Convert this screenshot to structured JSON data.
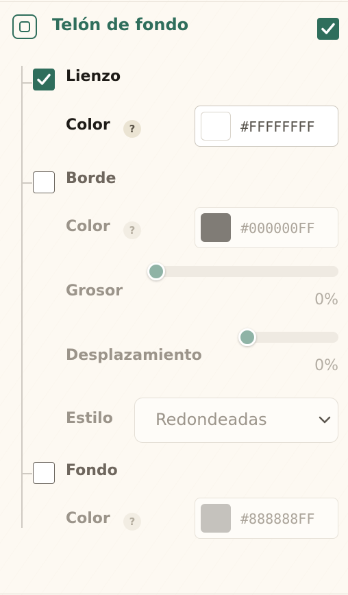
{
  "header": {
    "title": "Telón de fondo",
    "enabled": true
  },
  "sections": {
    "lienzo": {
      "label": "Lienzo",
      "checked": true,
      "color": {
        "label": "Color",
        "help": "?",
        "hex": "#FFFFFFFF",
        "swatch": "#ffffff"
      }
    },
    "borde": {
      "label": "Borde",
      "checked": false,
      "color": {
        "label": "Color",
        "help": "?",
        "hex": "#000000FF",
        "swatch": "#807c76"
      },
      "grosor": {
        "label": "Grosor",
        "value": "0%",
        "level": 0
      },
      "desplazamiento": {
        "label": "Desplazamiento",
        "value": "0%",
        "level": 0
      },
      "estilo": {
        "label": "Estilo",
        "selected": "Redondeadas"
      }
    },
    "fondo": {
      "label": "Fondo",
      "checked": false,
      "color": {
        "label": "Color",
        "help": "?",
        "hex": "#888888FF",
        "swatch": "#c5c2bd"
      }
    }
  },
  "colors": {
    "accent": "#2f6e5c",
    "background": "#fdf9f2",
    "slider_thumb": "#8fb3a6"
  },
  "icons": {
    "header": "square-in-square-icon",
    "check": "checkmark-icon",
    "help": "question-mark-icon",
    "select": "chevron-down-icon"
  }
}
